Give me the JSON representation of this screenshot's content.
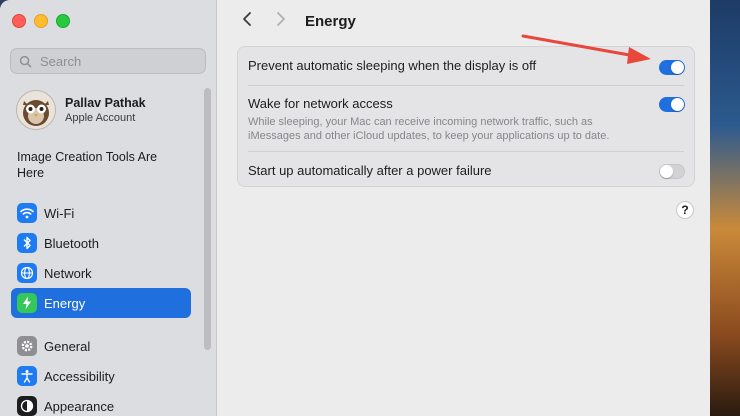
{
  "window": {
    "page_title": "Energy"
  },
  "search": {
    "placeholder": "Search"
  },
  "account": {
    "name": "Pallav Pathak",
    "subtitle": "Apple Account"
  },
  "promo": {
    "text": "Image Creation Tools Are Here"
  },
  "sidebar": {
    "items": [
      {
        "label": "Wi-Fi",
        "icon": "wifi-icon",
        "color": "#1f7bf2",
        "active": false
      },
      {
        "label": "Bluetooth",
        "icon": "bluetooth-icon",
        "color": "#1f7bf2",
        "active": false
      },
      {
        "label": "Network",
        "icon": "network-icon",
        "color": "#1f7bf2",
        "active": false
      },
      {
        "label": "Energy",
        "icon": "energy-icon",
        "color": "#34c759",
        "active": true
      },
      {
        "label": "General",
        "icon": "gear-icon",
        "color": "#8e8e93",
        "active": false
      },
      {
        "label": "Accessibility",
        "icon": "accessibility-icon",
        "color": "#1f7bf2",
        "active": false
      },
      {
        "label": "Appearance",
        "icon": "appearance-icon",
        "color": "#1d1d1f",
        "active": false
      }
    ]
  },
  "settings": {
    "rows": [
      {
        "title": "Prevent automatic sleeping when the display is off",
        "enabled": true
      },
      {
        "title": "Wake for network access",
        "description": "While sleeping, your Mac can receive incoming network traffic, such as iMessages and other iCloud updates, to keep your applications up to date.",
        "enabled": true
      },
      {
        "title": "Start up automatically after a power failure",
        "enabled": false
      }
    ]
  },
  "help": {
    "label": "?"
  },
  "colors": {
    "accent": "#1f6fde",
    "annotation_arrow": "#e8473b"
  }
}
